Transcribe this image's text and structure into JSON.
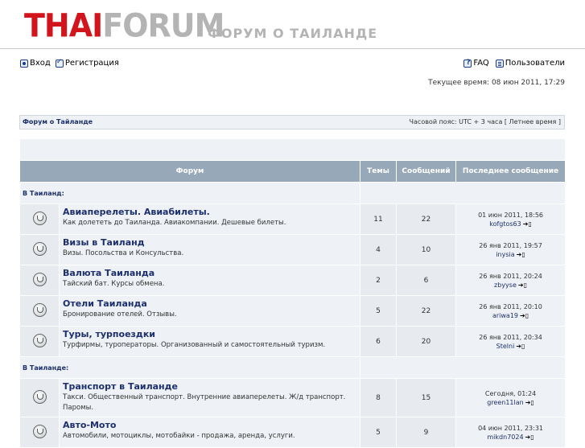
{
  "header": {
    "logo_thai": "THAI",
    "logo_forum": "FORUM",
    "tagline": "ФОРУМ О ТАИЛАНДЕ"
  },
  "toplinks": {
    "login": "Вход",
    "register": "Регистрация",
    "faq": "FAQ",
    "users": "Пользователи"
  },
  "current_time": "Текущее время: 08 июн 2011, 17:29",
  "navbar": {
    "breadcrumb": "Форум о Тайланде",
    "timezone": "Часовой пояс: UTC + 3 часа [ Летнее время ]"
  },
  "table": {
    "headers": {
      "forum": "Форум",
      "topics": "Темы",
      "posts": "Сообщений",
      "last_post": "Последнее сообщение"
    },
    "categories": [
      {
        "name": "В Таиланд:",
        "forums": [
          {
            "name": "Авиаперелеты. Авиабилеты.",
            "desc": "Как долететь до Таиланда. Авиакомпании. Дешевые билеты.",
            "topics": "11",
            "posts": "22",
            "last_date": "01 июн 2011, 18:56",
            "last_user": "kofgtos63"
          },
          {
            "name": "Визы в Таиланд",
            "desc": "Визы. Посольства и Консульства.",
            "topics": "4",
            "posts": "10",
            "last_date": "26 янв 2011, 19:57",
            "last_user": "inysia"
          },
          {
            "name": "Валюта Таиланда",
            "desc": "Тайский бат. Курсы обмена.",
            "topics": "2",
            "posts": "6",
            "last_date": "26 янв 2011, 20:24",
            "last_user": "zbyyse"
          },
          {
            "name": "Отели Таиланда",
            "desc": "Бронирование отелей. Отзывы.",
            "topics": "5",
            "posts": "22",
            "last_date": "26 янв 2011, 20:10",
            "last_user": "ariwa19"
          },
          {
            "name": "Туры, турпоездки",
            "desc": "Турфирмы, туроператоры. Организованный и самостоятельный туризм.",
            "topics": "6",
            "posts": "20",
            "last_date": "26 янв 2011, 20:34",
            "last_user": "Stelni"
          }
        ]
      },
      {
        "name": "В Таиланде:",
        "forums": [
          {
            "name": "Транспорт в Таиланде",
            "desc": "Такси. Общественный транспорт. Внутренние авиаперелеты. Ж/д транспорт. Паромы.",
            "topics": "8",
            "posts": "15",
            "last_date": "Сегодня, 01:24",
            "last_user": "green11lan"
          },
          {
            "name": "Авто-Мото",
            "desc": "Автомобили, мотоциклы, мотобайки - продажа, аренда, услуги.",
            "topics": "5",
            "posts": "9",
            "last_date": "04 июн 2011, 23:31",
            "last_user": "mikdn7024"
          }
        ]
      }
    ]
  }
}
